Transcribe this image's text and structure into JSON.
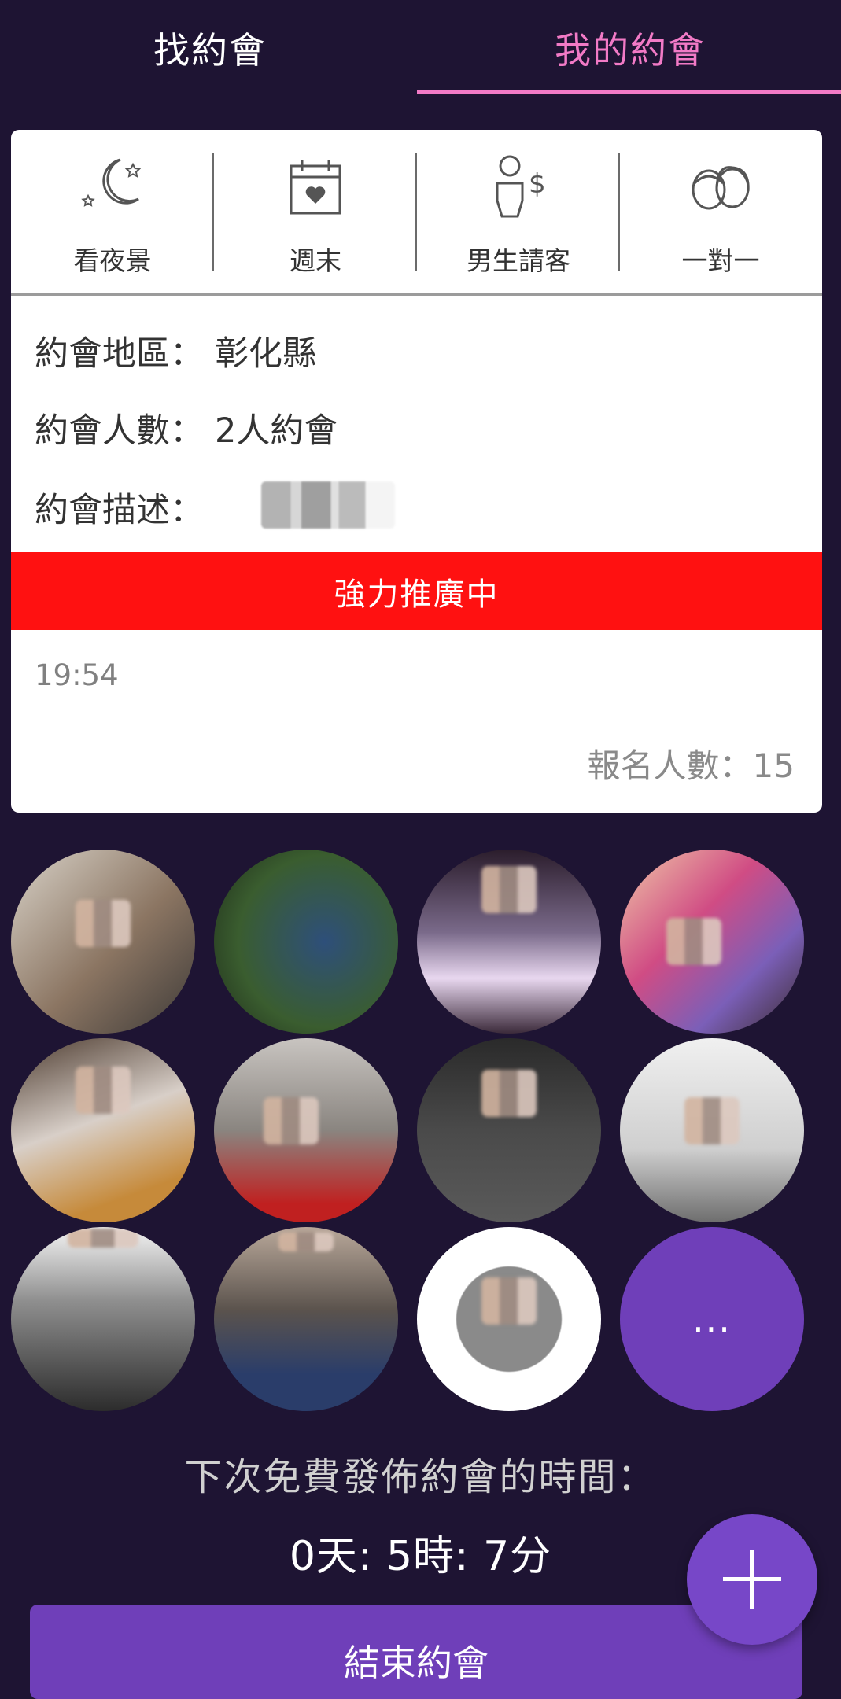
{
  "tabs": {
    "find": "找約會",
    "mine": "我的約會"
  },
  "card": {
    "tags": [
      {
        "label": "看夜景",
        "icon": "moon-stars-icon"
      },
      {
        "label": "週末",
        "icon": "calendar-heart-icon"
      },
      {
        "label": "男生請客",
        "icon": "man-dollar-icon"
      },
      {
        "label": "一對一",
        "icon": "couple-icon"
      }
    ],
    "region_label": "約會地區：",
    "region_value": "彰化縣",
    "people_label": "約會人數：",
    "people_value": "2人約會",
    "desc_label": "約會描述："
  },
  "promo": "強力推廣中",
  "time": "19:54",
  "count": "報名人數：15",
  "avatars": {
    "more_label": "..."
  },
  "next_free": {
    "label": "下次免費發佈約會的時間：",
    "countdown": "0天: 5時: 7分"
  },
  "end_button": "結束約會"
}
